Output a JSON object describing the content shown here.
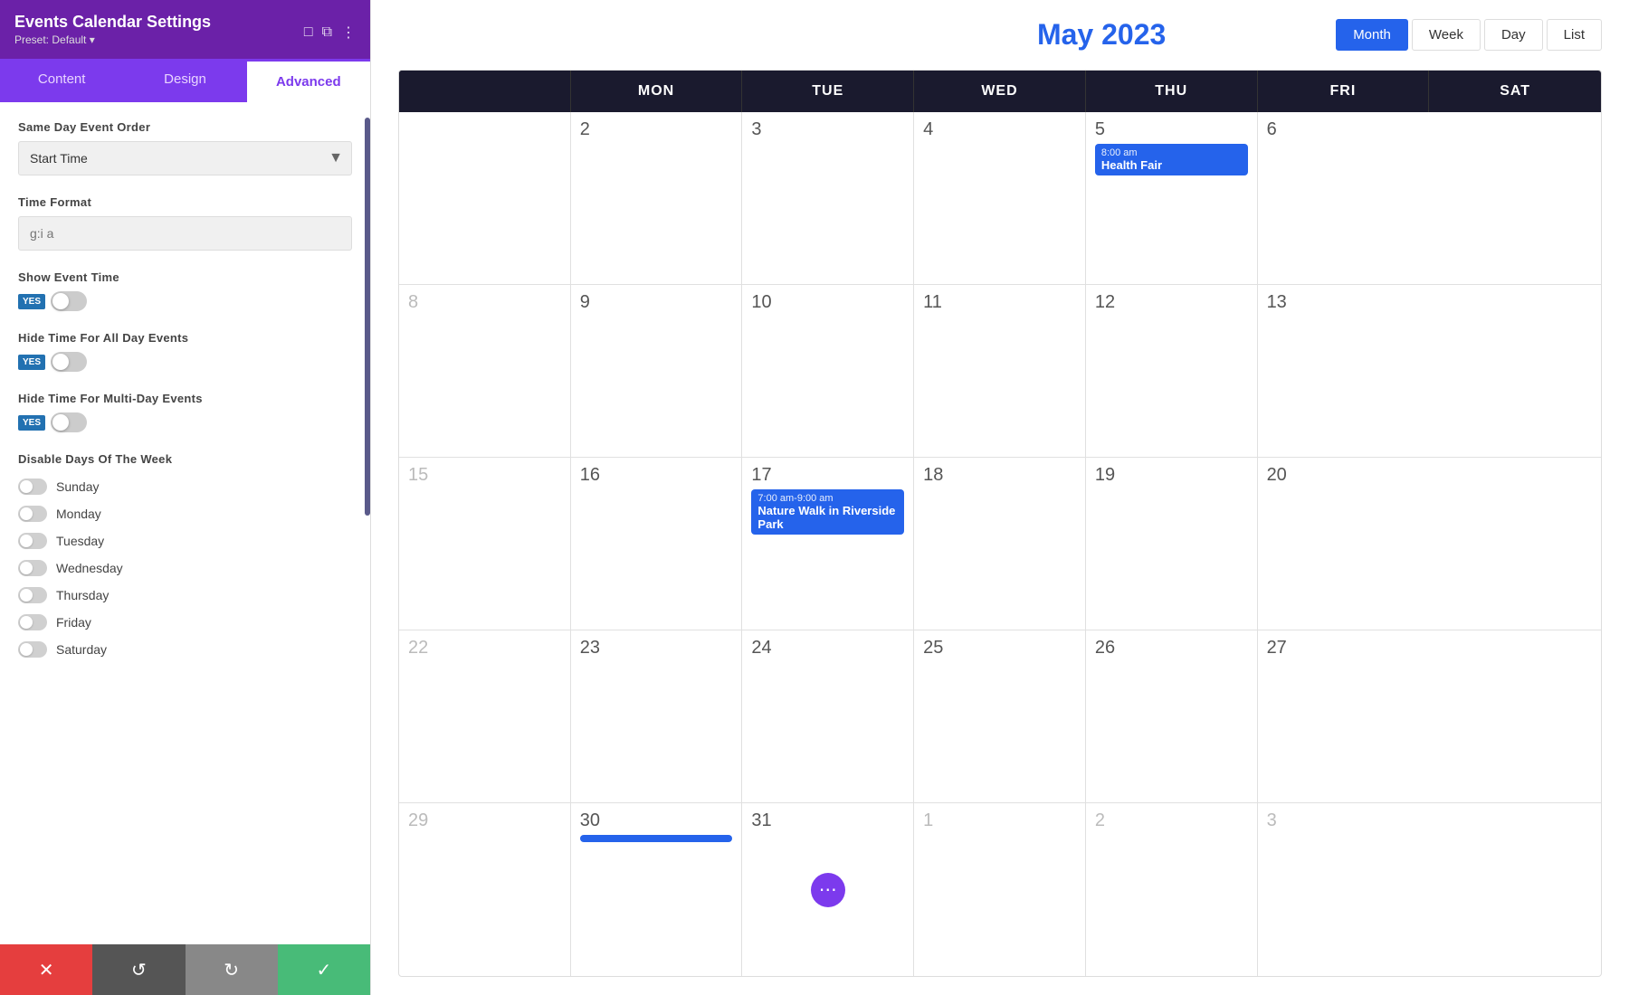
{
  "panel": {
    "title": "Events Calendar Settings",
    "preset": "Preset: Default ▾",
    "tabs": [
      {
        "id": "content",
        "label": "Content",
        "active": false
      },
      {
        "id": "design",
        "label": "Design",
        "active": false
      },
      {
        "id": "advanced",
        "label": "Advanced",
        "active": true
      }
    ],
    "fields": {
      "same_day_event_order": {
        "label": "Same Day Event Order",
        "value": "Start Time"
      },
      "time_format": {
        "label": "Time Format",
        "placeholder": "g:i a"
      },
      "show_event_time": {
        "label": "Show Event Time",
        "value": "YES"
      },
      "hide_time_all_day": {
        "label": "Hide Time For All Day Events",
        "value": "YES"
      },
      "hide_time_multi_day": {
        "label": "Hide Time For Multi-Day Events",
        "value": "YES"
      },
      "disable_days": {
        "label": "Disable Days Of The Week",
        "days": [
          "Sunday",
          "Monday",
          "Tuesday",
          "Wednesday",
          "Thursday",
          "Friday",
          "Saturday"
        ]
      }
    }
  },
  "bottom_bar": {
    "cancel_icon": "✕",
    "undo_icon": "↺",
    "redo_icon": "↻",
    "save_icon": "✓"
  },
  "calendar": {
    "title": "May 2023",
    "view_buttons": [
      {
        "label": "Month",
        "active": true
      },
      {
        "label": "Week",
        "active": false
      },
      {
        "label": "Day",
        "active": false
      },
      {
        "label": "List",
        "active": false
      }
    ],
    "day_headers": [
      "MON",
      "TUE",
      "WED",
      "THU",
      "FRI",
      "SAT"
    ],
    "weeks": [
      {
        "cells": [
          {
            "day": "2",
            "other": false,
            "events": []
          },
          {
            "day": "3",
            "other": false,
            "events": []
          },
          {
            "day": "4",
            "other": false,
            "events": []
          },
          {
            "day": "5",
            "other": false,
            "events": [
              {
                "time": "8:00 am",
                "name": "Health Fair"
              }
            ]
          },
          {
            "day": "6",
            "other": false,
            "events": []
          }
        ]
      },
      {
        "cells": [
          {
            "day": "8",
            "other": false,
            "partial": true,
            "events": []
          },
          {
            "day": "9",
            "other": false,
            "events": []
          },
          {
            "day": "10",
            "other": false,
            "events": []
          },
          {
            "day": "11",
            "other": false,
            "events": []
          },
          {
            "day": "12",
            "other": false,
            "events": []
          },
          {
            "day": "13",
            "other": false,
            "events": []
          }
        ]
      },
      {
        "cells": [
          {
            "day": "15",
            "other": false,
            "partial": true,
            "events": []
          },
          {
            "day": "16",
            "other": false,
            "events": []
          },
          {
            "day": "17",
            "other": false,
            "events": [
              {
                "time": "7:00 am-9:00 am",
                "name": "Nature Walk in Riverside Park"
              }
            ]
          },
          {
            "day": "18",
            "other": false,
            "events": []
          },
          {
            "day": "19",
            "other": false,
            "events": []
          },
          {
            "day": "20",
            "other": false,
            "events": []
          }
        ]
      },
      {
        "cells": [
          {
            "day": "22",
            "other": false,
            "partial": true,
            "events": []
          },
          {
            "day": "23",
            "other": false,
            "events": []
          },
          {
            "day": "24",
            "other": false,
            "events": []
          },
          {
            "day": "25",
            "other": false,
            "events": []
          },
          {
            "day": "26",
            "other": false,
            "events": []
          },
          {
            "day": "27",
            "other": false,
            "events": []
          }
        ]
      },
      {
        "cells": [
          {
            "day": "29",
            "other": false,
            "partial": true,
            "events": []
          },
          {
            "day": "30",
            "other": false,
            "events": []
          },
          {
            "day": "31",
            "other": false,
            "has_more": true,
            "events": []
          },
          {
            "day": "1",
            "other": true,
            "events": []
          },
          {
            "day": "2",
            "other": true,
            "events": []
          },
          {
            "day": "3",
            "other": true,
            "events": []
          }
        ]
      }
    ]
  }
}
